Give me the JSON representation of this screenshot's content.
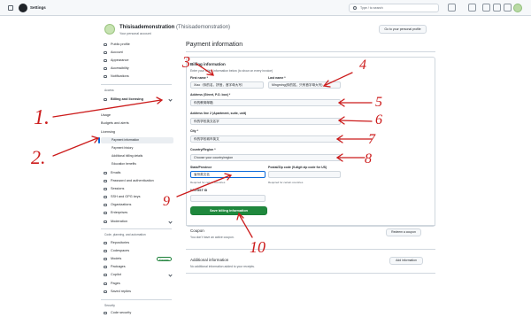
{
  "header": {
    "app_title": "Settings",
    "search_placeholder": "Type / to search",
    "icons": [
      "menu-icon",
      "github-logo-icon",
      "copilot-icon",
      "plus-icon",
      "issues-icon",
      "pull-requests-icon",
      "inbox-icon",
      "avatar"
    ]
  },
  "profile": {
    "username": "Thisisademonstration",
    "username_paren": "(Thisisademonstration)",
    "subtitle": "Your personal account",
    "goto_profile_label": "Go to your personal profile"
  },
  "sidebar": {
    "items": [
      {
        "label": "Public profile",
        "icon": "person-icon"
      },
      {
        "label": "Account",
        "icon": "gear-icon"
      },
      {
        "label": "Appearance",
        "icon": "paintbrush-icon"
      },
      {
        "label": "Accessibility",
        "icon": "accessibility-icon"
      },
      {
        "label": "Notifications",
        "icon": "bell-icon"
      }
    ],
    "access_group": "Access",
    "billing_label": "Billing and licensing",
    "billing_sub": [
      "Usage",
      "Budgets and alerts",
      "Licensing",
      "Payment information",
      "Payment history",
      "Additional billing details",
      "Education benefits"
    ],
    "items2": [
      {
        "label": "Emails",
        "icon": "mail-icon"
      },
      {
        "label": "Password and authentication",
        "icon": "shield-icon"
      },
      {
        "label": "Sessions",
        "icon": "broadcast-icon"
      },
      {
        "label": "SSH and GPG keys",
        "icon": "key-icon"
      },
      {
        "label": "Organizations",
        "icon": "organization-icon"
      },
      {
        "label": "Enterprises",
        "icon": "globe-icon"
      },
      {
        "label": "Moderation",
        "icon": "report-icon"
      }
    ],
    "code_group": "Code, planning, and automation",
    "items3": [
      {
        "label": "Repositories",
        "icon": "repo-icon"
      },
      {
        "label": "Codespaces",
        "icon": "codespaces-icon"
      },
      {
        "label": "Models",
        "icon": "models-icon",
        "badge": "Preview"
      },
      {
        "label": "Packages",
        "icon": "package-icon"
      },
      {
        "label": "Copilot",
        "icon": "copilot-icon"
      },
      {
        "label": "Pages",
        "icon": "browser-icon"
      },
      {
        "label": "Saved replies",
        "icon": "reply-icon"
      }
    ],
    "security_group": "Security",
    "items4": [
      {
        "label": "Code security",
        "icon": "shield-lock-icon"
      }
    ]
  },
  "main": {
    "title": "Payment information",
    "billing_title": "Billing information",
    "billing_desc": "Enter your billing information below (to show on every invoice)",
    "first_name_label": "First name *",
    "first_name_value": "Xiao（你的名，拼音，首字母大写）",
    "last_name_label": "Last name *",
    "last_name_value": "Mingming(你的姓，只有首字母大写)",
    "address_label": "Address (Street, P.O. box) *",
    "address_value": "你的教育邮箱",
    "address2_label": "Address line 2 (Apartment, suite, unit)",
    "address2_value": "你的学校英文名字",
    "city_label": "City *",
    "city_value": "你的学校城市英文",
    "country_label": "Country/Region *",
    "country_value": "Choose your country/region",
    "state_label": "State/Province",
    "state_value": "省份英文名",
    "state_help": "Required for certain countries",
    "postal_label": "Postal/Zip code (9-digit zip code for US)",
    "postal_help": "Required for certain countries",
    "vat_label": "VAT/GST ID",
    "save_label": "Save billing information",
    "coupon_title": "Coupon",
    "coupon_desc": "You don't have an active coupon.",
    "redeem_label": "Redeem a coupon",
    "additional_title": "Additional information",
    "additional_desc": "No additional information added to your receipts.",
    "add_info_label": "Add information"
  },
  "annotations": [
    "1.",
    "2.",
    "3",
    "4",
    "5",
    "6",
    "7",
    "8",
    "9",
    "10"
  ],
  "colors": {
    "annotation": "#cc1b1b",
    "accent": "#0969da",
    "save_button": "#1f883d"
  }
}
